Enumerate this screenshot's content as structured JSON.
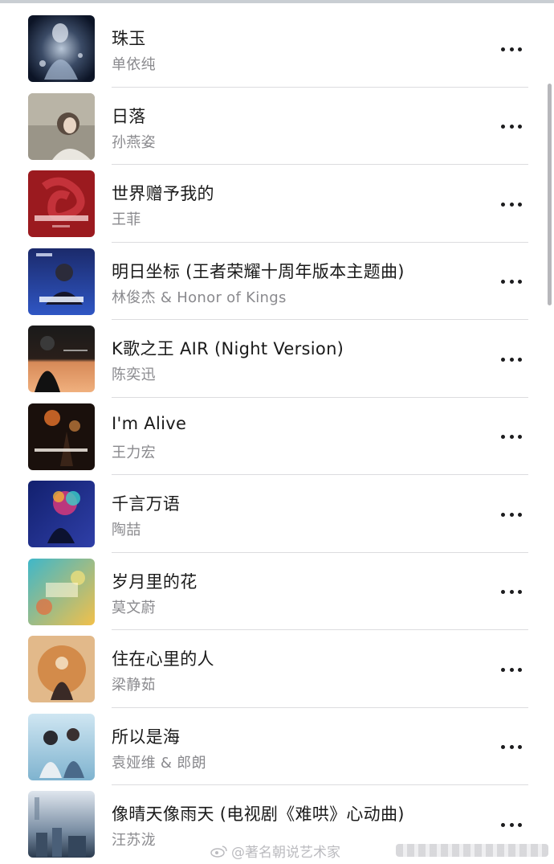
{
  "songs": [
    {
      "title": "珠玉",
      "artist": "单依纯",
      "cover_icon": "album-cover-zhuyu"
    },
    {
      "title": "日落",
      "artist": "孙燕姿",
      "cover_icon": "album-cover-riluo"
    },
    {
      "title": "世界赠予我的",
      "artist": "王菲",
      "cover_icon": "album-cover-shijie"
    },
    {
      "title": "明日坐标 (王者荣耀十周年版本主题曲)",
      "artist": "林俊杰 & Honor of Kings",
      "cover_icon": "album-cover-mingri"
    },
    {
      "title": "K歌之王 AIR (Night Version)",
      "artist": "陈奕迅",
      "cover_icon": "album-cover-kge"
    },
    {
      "title": "I'm Alive",
      "artist": "王力宏",
      "cover_icon": "album-cover-imalive"
    },
    {
      "title": "千言万语",
      "artist": "陶喆",
      "cover_icon": "album-cover-qianyan"
    },
    {
      "title": "岁月里的花",
      "artist": "莫文蔚",
      "cover_icon": "album-cover-suiyue"
    },
    {
      "title": "住在心里的人",
      "artist": "梁静茹",
      "cover_icon": "album-cover-zhuzai"
    },
    {
      "title": "所以是海",
      "artist": "袁娅维 & 郎朗",
      "cover_icon": "album-cover-suoyi"
    },
    {
      "title": "像晴天像雨天 (电视剧《难哄》心动曲)",
      "artist": "汪苏泷",
      "cover_icon": "album-cover-qingtian"
    }
  ],
  "more_icon": "more-options-icon",
  "watermark": {
    "text": "@著名朝说艺术家"
  }
}
